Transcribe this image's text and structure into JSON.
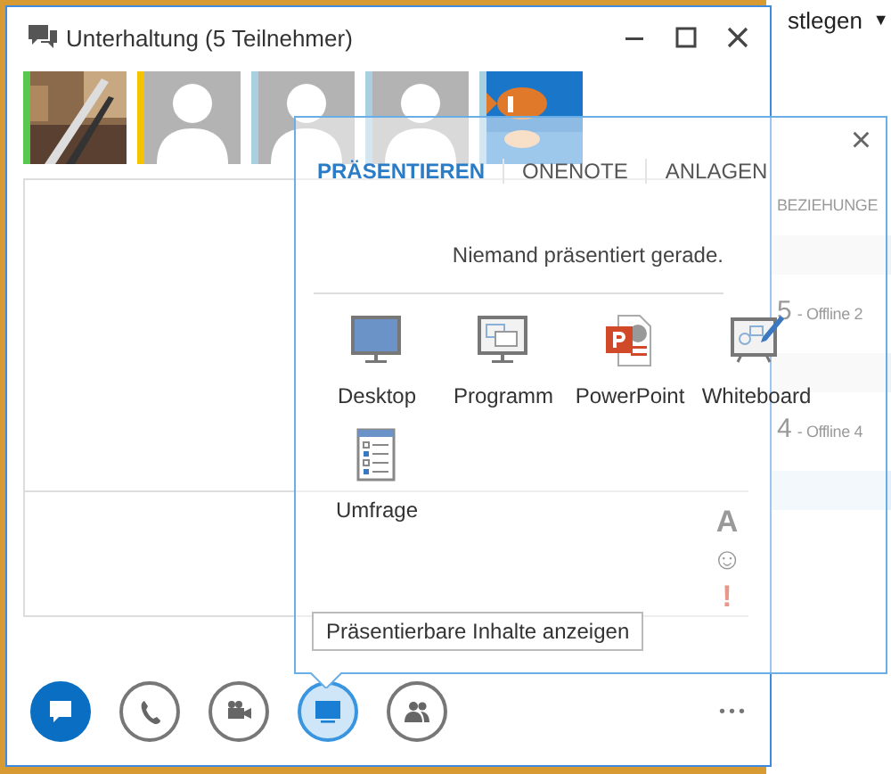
{
  "background_window": {
    "top_label": "stlegen",
    "top_caret": "▼",
    "section": "BEZIEHUNGE",
    "groups": [
      {
        "count": "5",
        "status": "- Offline 2"
      },
      {
        "count": "4",
        "status": "- Offline 4"
      }
    ]
  },
  "window": {
    "title": "Unterhaltung (5 Teilnehmer)"
  },
  "participants": [
    {
      "kind": "picture",
      "color": "#5ac84e"
    },
    {
      "kind": "placeholder",
      "color": "#f5c400"
    },
    {
      "kind": "placeholder",
      "color": "#a9cfe0"
    },
    {
      "kind": "placeholder",
      "color": "#a9cfe0"
    },
    {
      "kind": "picture",
      "color": "#a9cfe0"
    }
  ],
  "input_icons": [
    "A",
    "☺",
    "!"
  ],
  "toolbar": [
    {
      "kind": "chat",
      "selected": true,
      "expanded": false
    },
    {
      "kind": "call",
      "selected": false,
      "expanded": false
    },
    {
      "kind": "video",
      "selected": false,
      "expanded": false
    },
    {
      "kind": "present",
      "selected": false,
      "expanded": true
    },
    {
      "kind": "people",
      "selected": false,
      "expanded": false
    }
  ],
  "more": "•••",
  "popup": {
    "close": "×",
    "tabs": [
      {
        "label": "PRÄSENTIEREN",
        "selected": true
      },
      {
        "label": "ONENOTE",
        "selected": false
      },
      {
        "label": "ANLAGEN",
        "selected": false
      }
    ],
    "message": "Niemand präsentiert gerade.",
    "items": [
      {
        "kind": "desktop",
        "label": "Desktop"
      },
      {
        "kind": "program",
        "label": "Programm"
      },
      {
        "kind": "powerpoint",
        "label": "PowerPoint"
      },
      {
        "kind": "whiteboard",
        "label": "Whiteboard"
      },
      {
        "kind": "poll",
        "label": "Umfrage"
      }
    ],
    "button": "Präsentierbare Inhalte anzeigen"
  }
}
